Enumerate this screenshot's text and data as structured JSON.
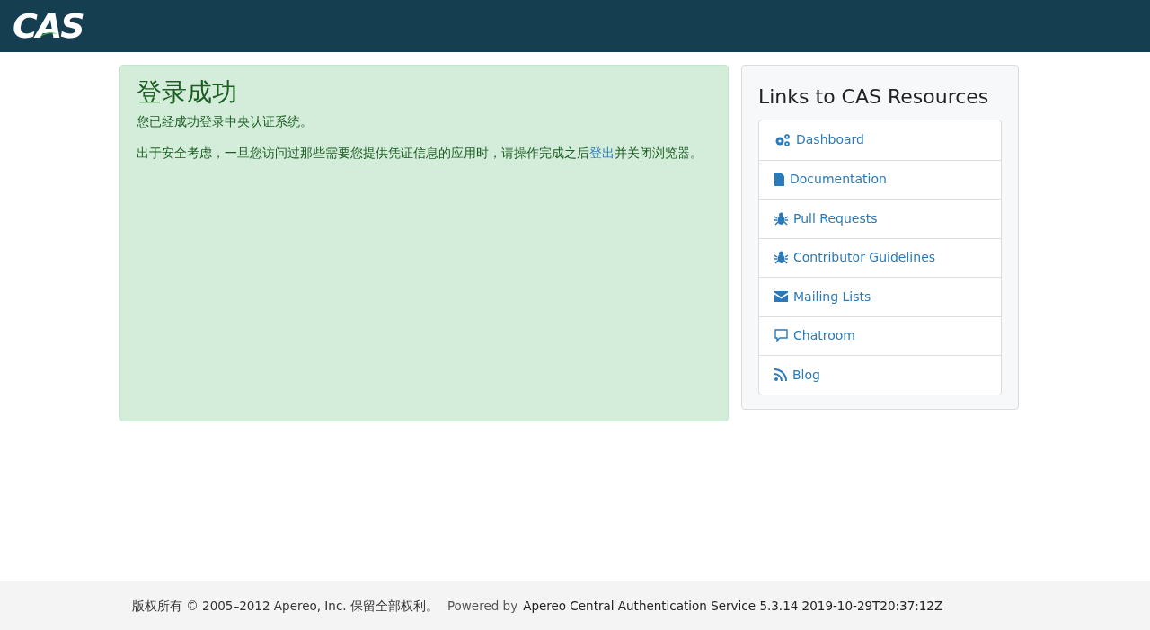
{
  "header": {
    "logo": "CAS"
  },
  "notice": {
    "title": "登录成功",
    "message": "您已经成功登录中央认证系统。",
    "warning": {
      "before": "出于安全考虑，一旦您访问过那些需要您提供凭证信息的应用时，请操作完成之后",
      "link": "登出",
      "after": "并关闭浏览器。"
    }
  },
  "resources": {
    "title": "Links to CAS Resources",
    "links": [
      {
        "kind": "gears",
        "label": "Dashboard"
      },
      {
        "kind": "file",
        "label": "Documentation"
      },
      {
        "kind": "bug",
        "label": "Pull Requests"
      },
      {
        "kind": "bug",
        "label": "Contributor Guidelines"
      },
      {
        "kind": "envelope",
        "label": "Mailing Lists"
      },
      {
        "kind": "comment",
        "label": "Chatroom"
      },
      {
        "kind": "rss",
        "label": "Blog"
      }
    ]
  },
  "footer": {
    "copyright": "版权所有 © 2005–2012 Apereo, Inc. 保留全部权利。",
    "powered_label": "Powered by",
    "powered_value": "Apereo Central Authentication Service 5.3.14 2019-10-29T20:37:12Z"
  }
}
